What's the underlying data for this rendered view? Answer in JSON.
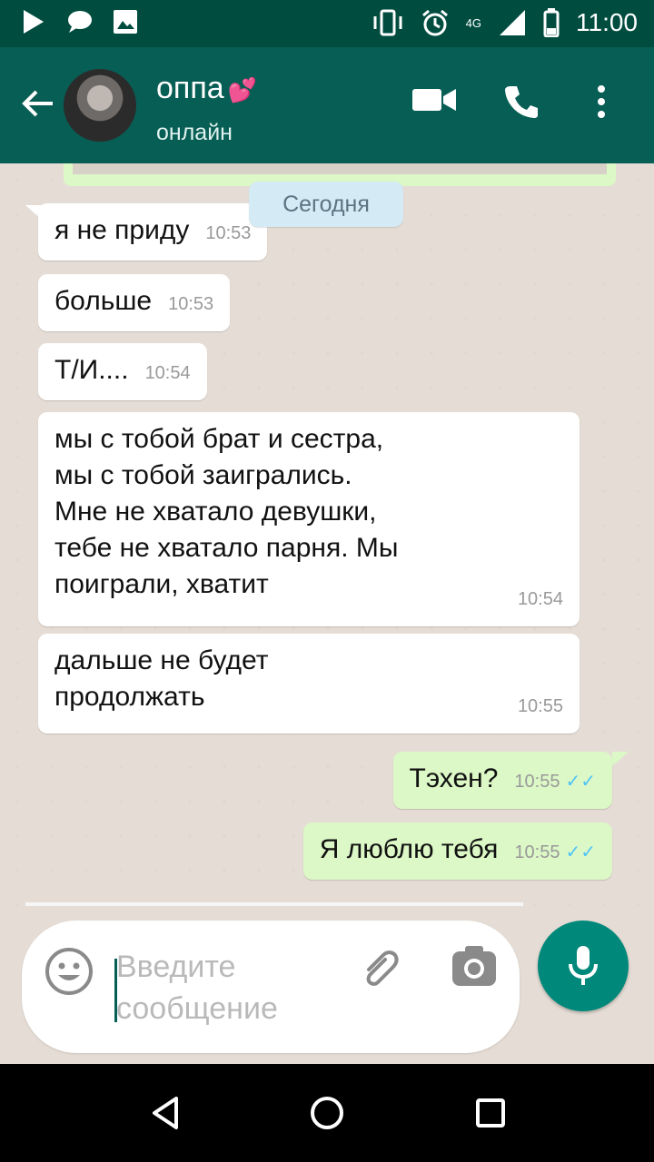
{
  "status_bar": {
    "time": "11:00",
    "network": "4G",
    "left_icons": [
      "play-icon",
      "chat-bubble-icon",
      "image-icon"
    ],
    "right_icons": [
      "vibrate-icon",
      "alarm-icon",
      "signal-icon",
      "battery-icon"
    ]
  },
  "header": {
    "contact_name": "оппа",
    "contact_emoji": "💕",
    "contact_status": "онлайн",
    "icons": [
      "back-arrow-icon",
      "video-call-icon",
      "phone-icon",
      "more-vert-icon"
    ]
  },
  "chat": {
    "date_label": "Сегодня",
    "messages": [
      {
        "direction": "in",
        "text": "я не приду",
        "time": "10:53"
      },
      {
        "direction": "in",
        "text": "больше",
        "time": "10:53"
      },
      {
        "direction": "in",
        "text": "Т/И....",
        "time": "10:54"
      },
      {
        "direction": "in",
        "lines": [
          "мы с тобой брат и сестра,",
          "мы с тобой заигрались.",
          "Мне не хватало девушки,",
          "тебе не хватало парня. Мы",
          "поиграли, хватит"
        ],
        "time": "10:54"
      },
      {
        "direction": "in",
        "lines": [
          "дальше не будет",
          "продолжать"
        ],
        "time": "10:55"
      },
      {
        "direction": "out",
        "text": "Тэхен?",
        "time": "10:55",
        "ticks": "✓✓"
      },
      {
        "direction": "out",
        "text": "Я люблю тебя",
        "time": "10:55",
        "ticks": "✓✓"
      }
    ]
  },
  "composer": {
    "placeholder_lines": [
      "Введите",
      "сообщение"
    ],
    "icons": [
      "emoji-icon",
      "attach-icon",
      "camera-icon",
      "mic-icon"
    ]
  },
  "colors": {
    "header": "#075e54",
    "status_bar": "#004d40",
    "chat_bg": "#e5ddd5",
    "outgoing_bubble": "#dcf8c6",
    "incoming_bubble": "#ffffff",
    "accent": "#00897b",
    "read_ticks": "#4fc3f7"
  }
}
